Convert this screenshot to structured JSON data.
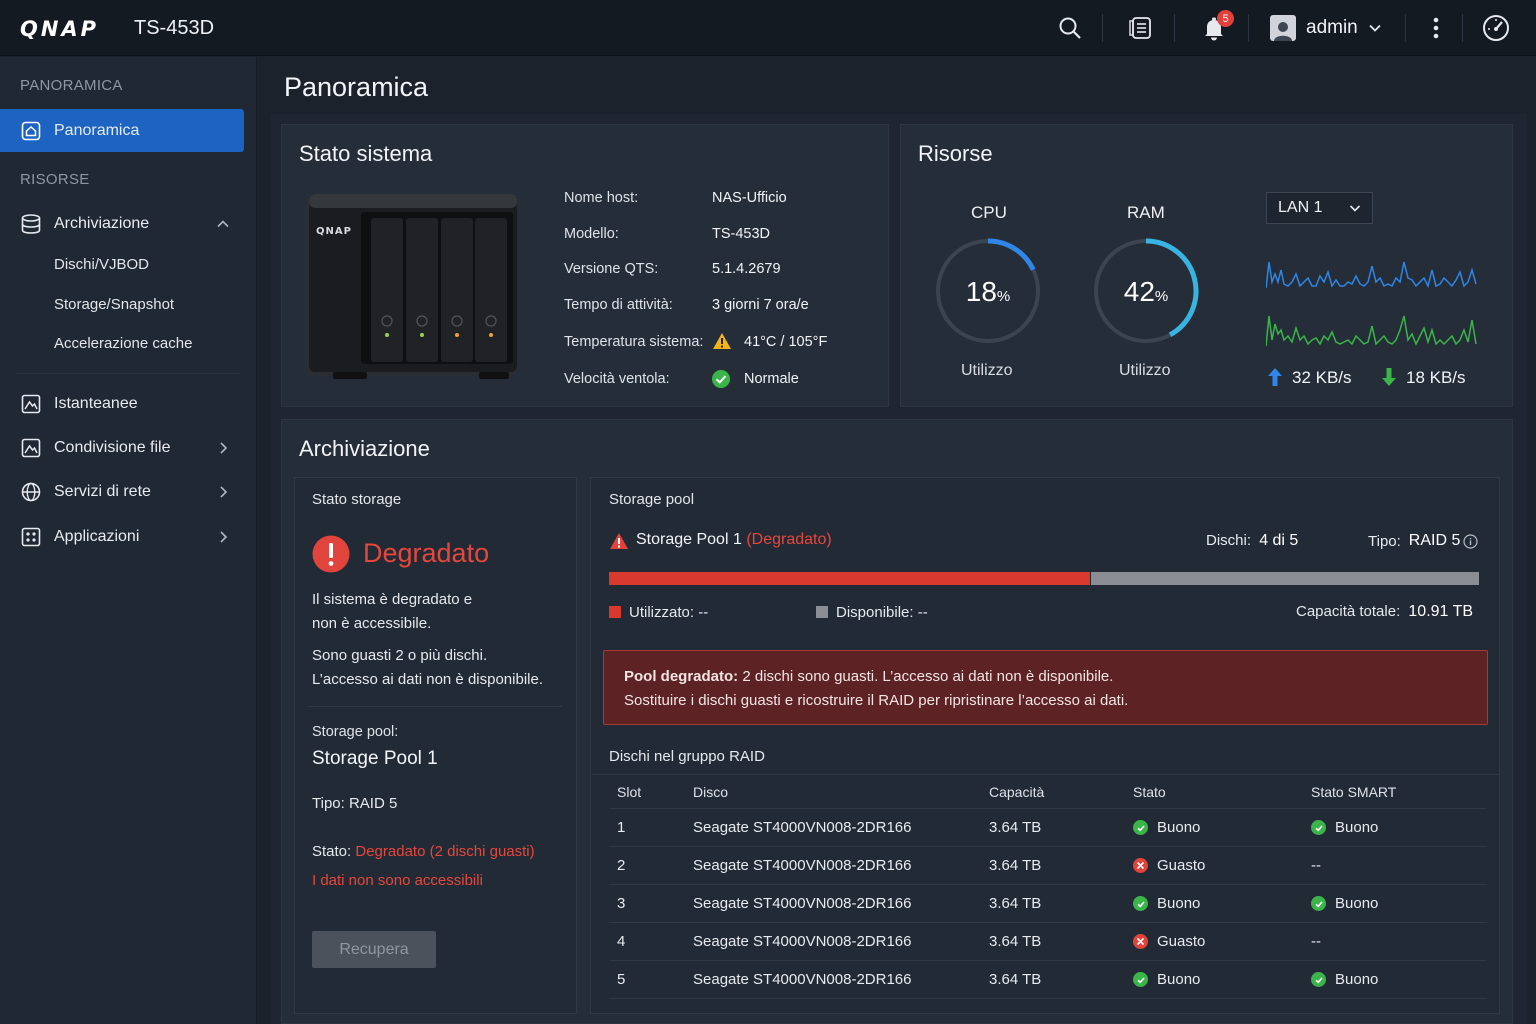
{
  "topbar": {
    "logo": "QNAP",
    "model": "TS-453D",
    "notifications_count": "5",
    "username": "admin",
    "icons": [
      "search-icon",
      "task-list-icon",
      "bell-icon",
      "user-icon",
      "more-vertical-icon",
      "dashboard-gauge-icon"
    ]
  },
  "sidebar": {
    "section_overview": "PANORAMICA",
    "overview_item": "Panoramica",
    "section_resources": "RISORSE",
    "storage": {
      "label": "Archiviazione",
      "children": [
        "Dischi/VJBOD",
        "Storage/Snapshot",
        "Accelerazione cache"
      ]
    },
    "items": [
      {
        "label": "Istanteanee",
        "icon": "snapshot-icon"
      },
      {
        "label": "Condivisione file",
        "icon": "file-share-icon"
      },
      {
        "label": "Servizi di rete",
        "icon": "globe-icon"
      },
      {
        "label": "Applicazioni",
        "icon": "apps-icon"
      }
    ]
  },
  "page_title": "Panoramica",
  "system_status": {
    "title": "Stato sistema",
    "device_logo": "QNAP",
    "rows": [
      {
        "label": "Nome host:",
        "value": "NAS-Ufficio"
      },
      {
        "label": "Modello:",
        "value": "TS-453D"
      },
      {
        "label": "Versione QTS:",
        "value": "5.1.4.2679"
      },
      {
        "label": "Tempo di attività:",
        "value": "3 giorni 7 ora/e"
      },
      {
        "label": "Temperatura sistema:",
        "value": "41°C / 105°F"
      },
      {
        "label": "Velocità ventola:",
        "value": "Normale"
      }
    ]
  },
  "resources": {
    "title": "Risorse",
    "cpu": {
      "title": "CPU",
      "value": "18",
      "unit": "%",
      "sub": "Utilizzo",
      "fraction": 0.18,
      "color": "#2f86e6"
    },
    "ram": {
      "title": "RAM",
      "value": "42",
      "unit": "%",
      "sub": "Utilizzo",
      "fraction": 0.42,
      "color": "#39b4e0"
    },
    "lan_select": "LAN 1",
    "upload": "32 KB/s",
    "download": "18 KB/s",
    "colors": {
      "upload": "#2f86e6",
      "download": "#3bb54a"
    }
  },
  "storage": {
    "title": "Archiviazione",
    "status_card": {
      "title": "Stato storage",
      "state": "Degradato",
      "desc1_l1": "Il sistema è degradato e",
      "desc1_l2": "non è accessibile.",
      "desc2_l1": "Sono guasti 2 o più dischi.",
      "desc2_l2": "L’accesso ai dati non è disponibile.",
      "pool_label": "Storage pool:",
      "pool_name": "Storage Pool 1",
      "type_label": "Tipo:",
      "type_value": "RAID 5",
      "state_label": "Stato:",
      "state_value": "Degradato (2 dischi guasti)",
      "data_inaccessible": "I dati non sono accessibili",
      "recover_button": "Recupera"
    },
    "pool_card": {
      "title": "Storage pool",
      "pool_name": "Storage Pool 1",
      "pool_state": "(Degradato)",
      "disks_label": "Dischi:",
      "disks_value": "4 di 5",
      "type_label": "Tipo:",
      "type_value": "RAID 5",
      "used_label": "Utilizzato:",
      "used_value": "--",
      "free_label": "Disponibile:",
      "free_value": "--",
      "total_label": "Capacità totale:",
      "total_value": "10.91 TB",
      "colors": {
        "used": "#d9392f",
        "free": "#8a8d93"
      },
      "alert_bold": "Pool degradato:",
      "alert_text1": "2 dischi sono guasti. L’accesso ai dati non è disponibile.",
      "alert_text2": "Sostituire i dischi guasti e ricostruire il RAID per ripristinare l’accesso ai dati.",
      "table_title": "Dischi nel gruppo RAID",
      "columns": [
        "Slot",
        "Disco",
        "Capacità",
        "Stato",
        "Stato SMART"
      ],
      "rows": [
        {
          "slot": "1",
          "disk": "Seagate ST4000VN008-2DR166",
          "capacity": "3.64 TB",
          "state": "Buono",
          "state_ok": true,
          "smart": "Buono",
          "smart_ok": true
        },
        {
          "slot": "2",
          "disk": "Seagate ST4000VN008-2DR166",
          "capacity": "3.64 TB",
          "state": "Guasto",
          "state_ok": false,
          "smart": "--",
          "smart_ok": null
        },
        {
          "slot": "3",
          "disk": "Seagate ST4000VN008-2DR166",
          "capacity": "3.64 TB",
          "state": "Buono",
          "state_ok": true,
          "smart": "Buono",
          "smart_ok": true
        },
        {
          "slot": "4",
          "disk": "Seagate ST4000VN008-2DR166",
          "capacity": "3.64 TB",
          "state": "Guasto",
          "state_ok": false,
          "smart": "--",
          "smart_ok": null
        },
        {
          "slot": "5",
          "disk": "Seagate ST4000VN008-2DR166",
          "capacity": "3.64 TB",
          "state": "Buono",
          "state_ok": true,
          "smart": "Buono",
          "smart_ok": true
        }
      ]
    }
  }
}
